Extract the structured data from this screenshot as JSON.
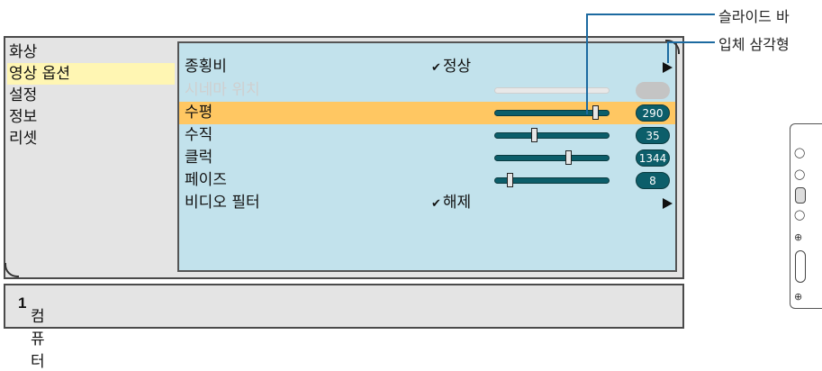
{
  "nav": {
    "items": [
      {
        "label": "화상"
      },
      {
        "label": "영상 옵션"
      },
      {
        "label": "설정"
      },
      {
        "label": "정보"
      },
      {
        "label": "리셋"
      }
    ],
    "selected_index": 1
  },
  "options": {
    "rows": [
      {
        "label": "종횡비",
        "value": "정상",
        "checkmark": "✔",
        "has_arrow": true
      },
      {
        "label": "시네마 위치",
        "disabled": true,
        "slider_level": 0.5,
        "pill": ""
      },
      {
        "label": "수평",
        "selected": true,
        "slider_level": 0.88,
        "pill": "290"
      },
      {
        "label": "수직",
        "slider_level": 0.35,
        "pill": "35"
      },
      {
        "label": "클럭",
        "slider_level": 0.65,
        "pill": "1344"
      },
      {
        "label": "페이즈",
        "slider_level": 0.14,
        "pill": "8"
      },
      {
        "label": "비디오 필터",
        "value": "해제",
        "checkmark": "✔",
        "has_arrow": true
      }
    ]
  },
  "source": {
    "label": "컴퓨터",
    "number": "1"
  },
  "callouts": {
    "slider_bar": "슬라이드 바",
    "solid_triangle": "입체 삼각형"
  },
  "colors": {
    "panel_bg": "#c2e2ec",
    "selected_row": "#ffc762",
    "selected_nav": "#fff6b3",
    "slider_track": "#0c5e6a",
    "callout_line": "#1c6aa0"
  },
  "icons": {
    "submenu_arrow": "right-triangle-icon",
    "checkmark": "checkmark-icon"
  }
}
